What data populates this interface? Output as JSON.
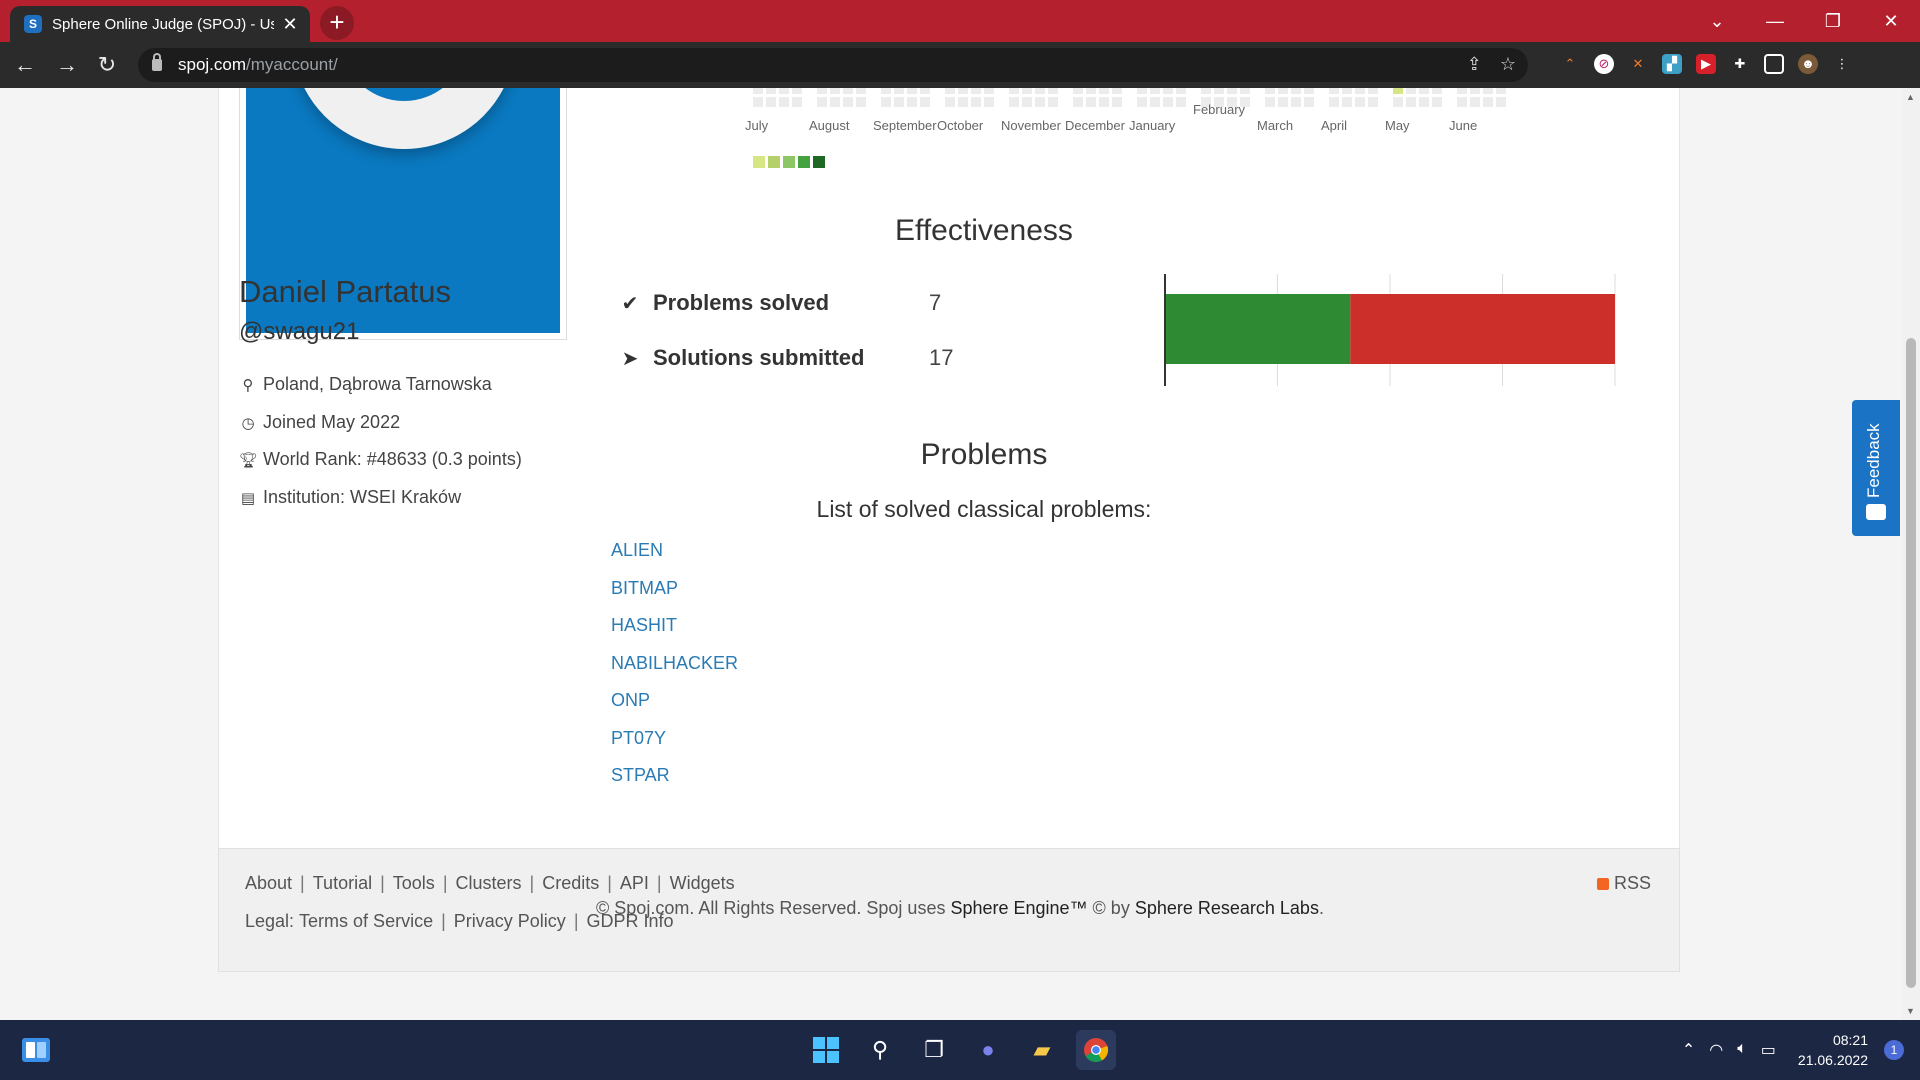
{
  "browser": {
    "tab_title": "Sphere Online Judge (SPOJ) - Us",
    "tab_favicon": "S",
    "url_host": "spoj.com",
    "url_path": "/myaccount/"
  },
  "profile": {
    "name": "Daniel Partatus",
    "handle": "@swagu21",
    "location": "Poland, Dąbrowa Tarnowska",
    "joined": "Joined May 2022",
    "world_rank": "World Rank: #48633 (0.3 points)",
    "institution": "Institution: WSEI Kraków"
  },
  "activity": {
    "months": [
      "July",
      "August",
      "September",
      "October",
      "November",
      "December",
      "January",
      "February",
      "March",
      "April",
      "May",
      "June"
    ],
    "legend_colors": [
      "#d6e685",
      "#b5cf6b",
      "#8cc665",
      "#44a340",
      "#1e6823"
    ]
  },
  "effectiveness": {
    "title": "Effectiveness",
    "problems_solved_label": "Problems solved",
    "problems_solved_value": "7",
    "solutions_submitted_label": "Solutions submitted",
    "solutions_submitted_value": "17",
    "chart_data": {
      "type": "bar",
      "orientation": "horizontal-stacked",
      "series": [
        {
          "name": "",
          "values": [
            7
          ],
          "color": "#2e8b34"
        },
        {
          "name": "",
          "values": [
            10
          ],
          "color": "#cc2e2a"
        }
      ],
      "xlim": [
        0,
        17
      ],
      "grid": true
    }
  },
  "problems": {
    "title": "Problems",
    "subtitle": "List of solved classical problems:",
    "items": [
      "ALIEN",
      "BITMAP",
      "HASHIT",
      "NABILHACKER",
      "ONP",
      "PT07Y",
      "STPAR"
    ]
  },
  "footer": {
    "links": [
      "About",
      "Tutorial",
      "Tools",
      "Clusters",
      "Credits",
      "API",
      "Widgets"
    ],
    "legal_prefix": "Legal:",
    "legal_links": [
      "Terms of Service",
      "Privacy Policy",
      "GDPR Info"
    ],
    "rss": "RSS",
    "copyright_prefix": "© Spoj.com. All Rights Reserved. Spoj uses ",
    "sphere_engine": "Sphere Engine™",
    "copyright_mid": " © by ",
    "sphere_labs": "Sphere Research Labs",
    "copyright_end": "."
  },
  "feedback_label": "Feedback",
  "taskbar": {
    "time": "08:21",
    "date": "21.06.2022",
    "notifications": "1"
  }
}
